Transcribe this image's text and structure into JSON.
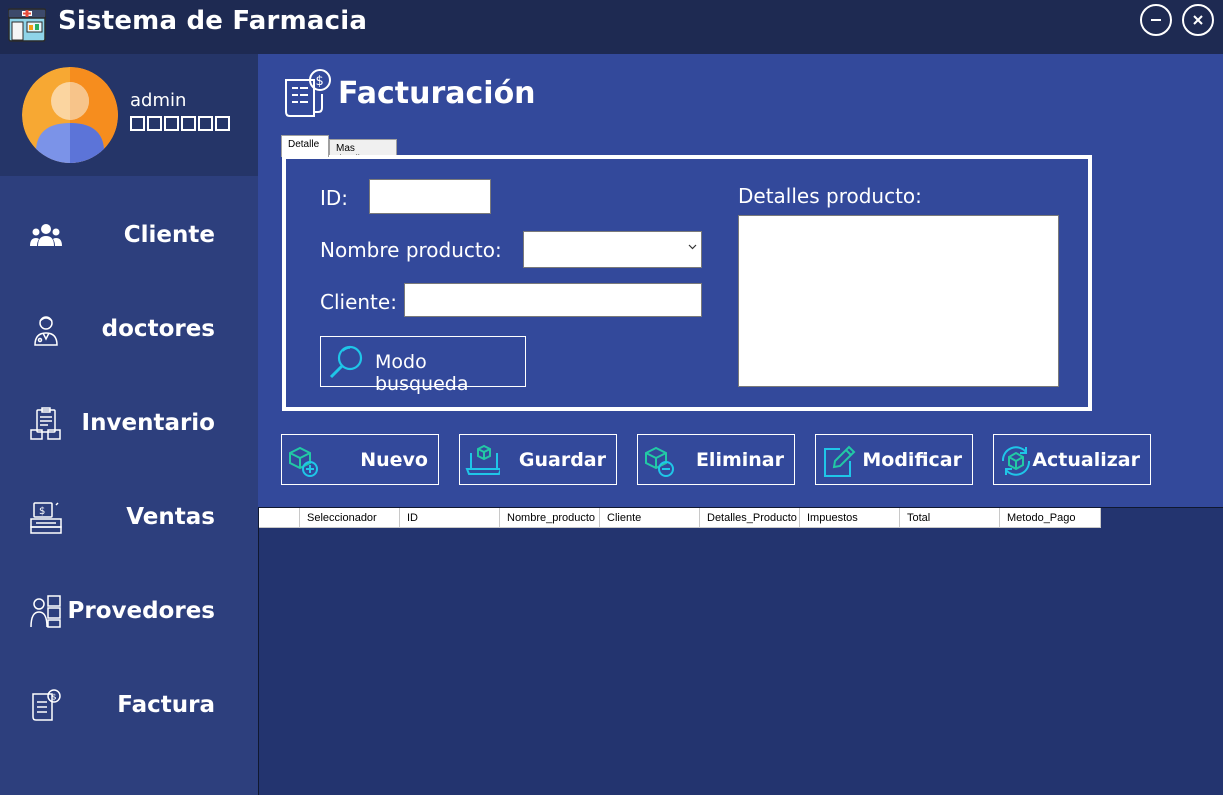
{
  "app": {
    "title": "Sistema de Farmacia"
  },
  "window_controls": {
    "minimize_icon": "minus-circle-icon",
    "close_icon": "x-circle-icon"
  },
  "profile": {
    "username": "admin"
  },
  "sidebar": {
    "items": [
      {
        "label": "Cliente",
        "icon": "users-icon"
      },
      {
        "label": "doctores",
        "icon": "doctor-icon"
      },
      {
        "label": "Inventario",
        "icon": "inventory-icon"
      },
      {
        "label": "Ventas",
        "icon": "sales-register-icon"
      },
      {
        "label": "Provedores",
        "icon": "supplier-icon"
      },
      {
        "label": "Factura",
        "icon": "invoice-icon"
      }
    ]
  },
  "page": {
    "title": "Facturación",
    "icon": "invoice-icon"
  },
  "tabs": [
    {
      "label": "Detalle",
      "active": true
    },
    {
      "label": "Mas detalles",
      "active": false
    }
  ],
  "form": {
    "id_label": "ID:",
    "id_value": "",
    "product_label": "Nombre producto:",
    "product_value": "",
    "client_label": "Cliente:",
    "client_value": "",
    "details_label": "Detalles producto:",
    "details_value": "",
    "search_button": "Modo busqueda"
  },
  "actions": {
    "new": "Nuevo",
    "save": "Guardar",
    "delete": "Eliminar",
    "edit": "Modificar",
    "refresh": "Actualizar"
  },
  "accent_colors": {
    "icon_cyan": "#1fc6e8",
    "icon_teal": "#22c9a5",
    "main_blue": "#33499b",
    "sidebar_blue": "#2d3f7d",
    "titlebar": "#1e2a52"
  },
  "grid": {
    "columns": [
      "",
      "Seleccionador",
      "ID",
      "Nombre_producto",
      "Cliente",
      "Detalles_Producto",
      "Impuestos",
      "Total",
      "Metodo_Pago"
    ],
    "rows": []
  }
}
